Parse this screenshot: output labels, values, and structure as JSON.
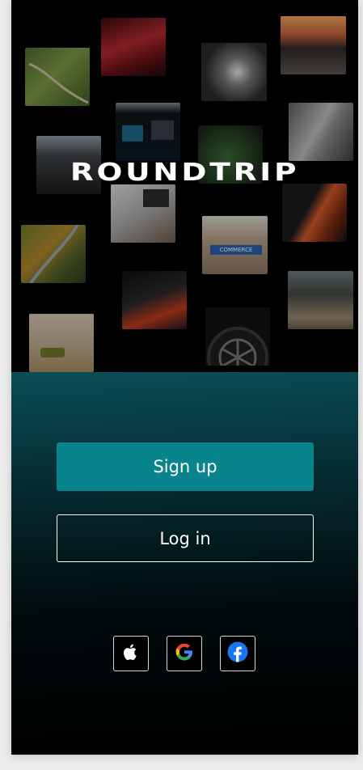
{
  "app": {
    "logo_text": "ROUNDTRIP"
  },
  "actions": {
    "sign_up_label": "Sign up",
    "log_in_label": "Log in"
  },
  "social": {
    "providers": [
      {
        "name": "apple",
        "icon": "apple-icon"
      },
      {
        "name": "google",
        "icon": "google-icon"
      },
      {
        "name": "facebook",
        "icon": "facebook-icon"
      }
    ]
  },
  "hero": {
    "street_sign_text": "COMMERCE"
  },
  "colors": {
    "primary": "#08848d",
    "panel_top": "#0a4e55",
    "background": "#000000",
    "facebook": "#1877f2",
    "google_blue": "#4285f4",
    "google_red": "#ea4335",
    "google_yellow": "#fbbc05",
    "google_green": "#34a853"
  }
}
